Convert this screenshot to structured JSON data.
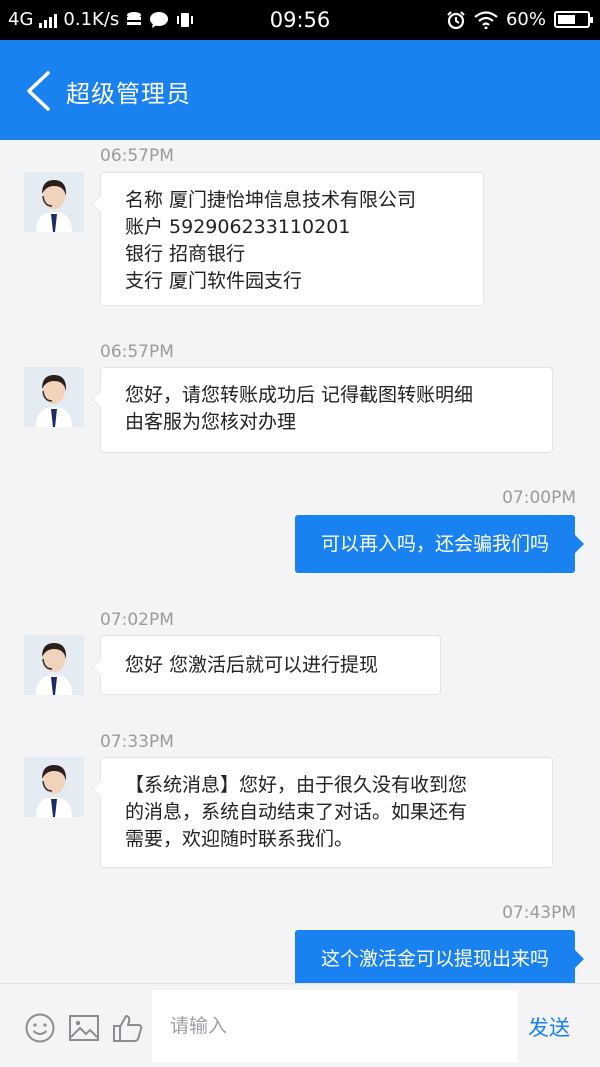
{
  "status_bar": {
    "network": "4G",
    "speed": "0.1K/s",
    "time": "09:56",
    "battery": "60%",
    "battery_level": 0.6
  },
  "header": {
    "title": "超级管理员"
  },
  "messages": [
    {
      "time": "06:57PM",
      "lines": [
        "名称 厦门捷怡坤信息技术有限公司",
        "账户 592906233110201",
        "银行 招商银行",
        "支行 厦门软件园支行"
      ]
    },
    {
      "time": "06:57PM",
      "lines": [
        "您好，请您转账成功后 记得截图转账明细",
        "由客服为您核对办理"
      ]
    },
    {
      "time": "07:00PM",
      "text": "可以再入吗，还会骗我们吗"
    },
    {
      "time": "07:02PM",
      "lines": [
        "您好 您激活后就可以进行提现"
      ]
    },
    {
      "time": "07:33PM",
      "lines": [
        "【系统消息】您好，由于很久没有收到您",
        "的消息，系统自动结束了对话。如果还有",
        "需要，欢迎随时联系我们。"
      ]
    },
    {
      "time": "07:43PM",
      "text": "这个激活金可以提现出来吗"
    }
  ],
  "input_bar": {
    "placeholder": "请输入",
    "send_label": "发送"
  },
  "colors": {
    "accent": "#1a82f0",
    "background": "#f4f4f6"
  }
}
